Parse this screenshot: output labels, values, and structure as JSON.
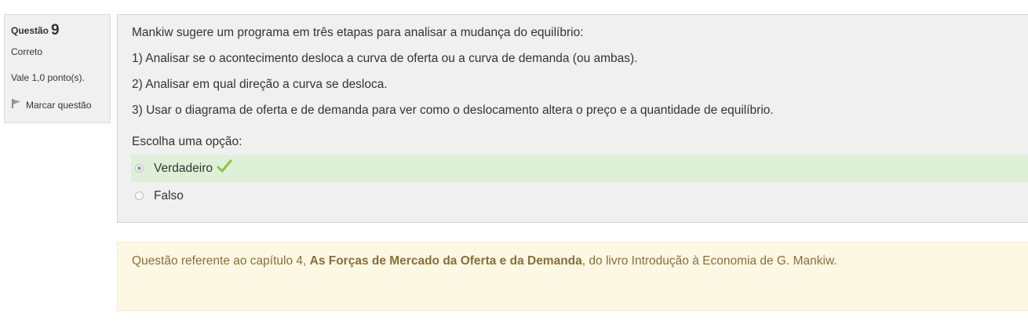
{
  "info": {
    "question_label": "Questão",
    "question_number": "9",
    "state": "Correto",
    "grade": "Vale 1,0 ponto(s).",
    "flag_label": "Marcar questão"
  },
  "question": {
    "lines": [
      "Mankiw sugere um programa em três etapas para analisar a mudança do equilíbrio:",
      "1) Analisar se o acontecimento desloca a curva de oferta ou a curva de demanda (ou ambas).",
      "2) Analisar em qual direção a curva se desloca.",
      "3) Usar o diagrama de oferta e de demanda para ver como o deslocamento altera o preço e a quantidade de equilíbrio."
    ],
    "prompt": "Escolha uma opção:",
    "options": [
      {
        "label": "Verdadeiro",
        "selected": true,
        "correct": true
      },
      {
        "label": "Falso",
        "selected": false,
        "correct": false
      }
    ]
  },
  "feedback": {
    "prefix": "Questão referente ao capítulo 4, ",
    "chapter_title": "As Forças de Mercado da Oferta e da Demanda",
    "suffix": ", do livro Introdução à Economia de G. Mankiw."
  },
  "colors": {
    "correct_bg": "#dff0d8",
    "check_icon": "#8cc63f",
    "feedback_bg": "#fcf8e3",
    "feedback_text": "#8a6d3b"
  }
}
